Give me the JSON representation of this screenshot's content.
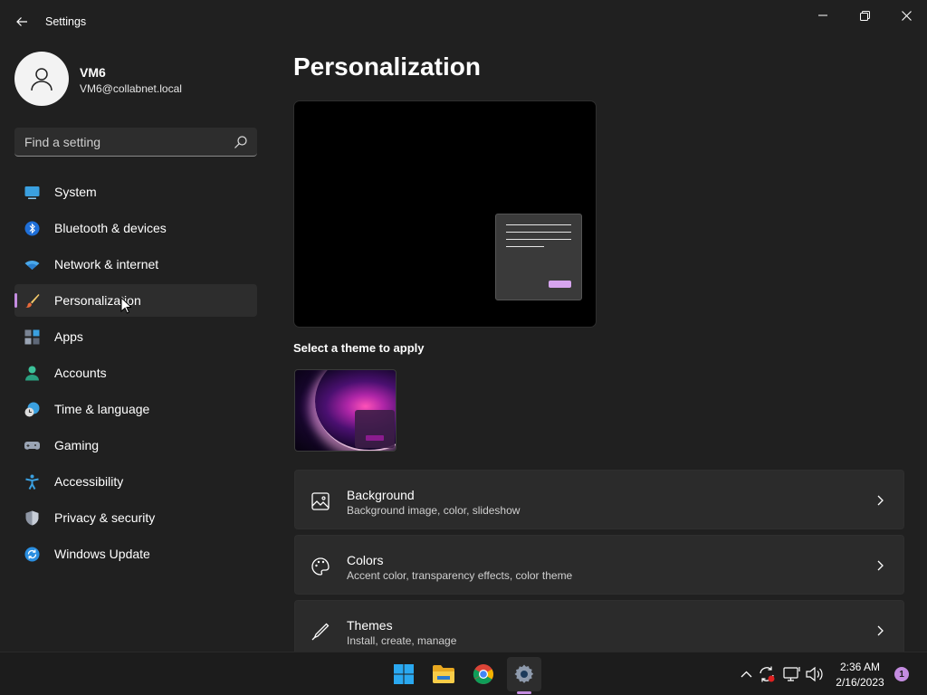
{
  "window": {
    "title": "Settings"
  },
  "profile": {
    "name": "VM6",
    "email": "VM6@collabnet.local"
  },
  "search": {
    "placeholder": "Find a setting"
  },
  "nav": {
    "items": [
      {
        "label": "System",
        "icon": "monitor-icon"
      },
      {
        "label": "Bluetooth & devices",
        "icon": "bluetooth-icon"
      },
      {
        "label": "Network & internet",
        "icon": "wifi-icon"
      },
      {
        "label": "Personalization",
        "icon": "brush-icon",
        "active": true
      },
      {
        "label": "Apps",
        "icon": "apps-icon"
      },
      {
        "label": "Accounts",
        "icon": "person-icon"
      },
      {
        "label": "Time & language",
        "icon": "clock-globe-icon"
      },
      {
        "label": "Gaming",
        "icon": "gamepad-icon"
      },
      {
        "label": "Accessibility",
        "icon": "accessibility-icon"
      },
      {
        "label": "Privacy & security",
        "icon": "shield-icon"
      },
      {
        "label": "Windows Update",
        "icon": "update-icon"
      }
    ]
  },
  "main": {
    "title": "Personalization",
    "theme_caption": "Select a theme to apply",
    "cards": [
      {
        "title": "Background",
        "subtitle": "Background image, color, slideshow",
        "icon": "image-icon"
      },
      {
        "title": "Colors",
        "subtitle": "Accent color, transparency effects, color theme",
        "icon": "palette-icon"
      },
      {
        "title": "Themes",
        "subtitle": "Install, create, manage",
        "icon": "pen-icon"
      }
    ]
  },
  "taskbar": {
    "time": "2:36 AM",
    "date": "2/16/2023",
    "notification_count": "1"
  },
  "colors": {
    "accent": "#c48ce0",
    "background": "#202020",
    "card": "#2b2b2b"
  }
}
